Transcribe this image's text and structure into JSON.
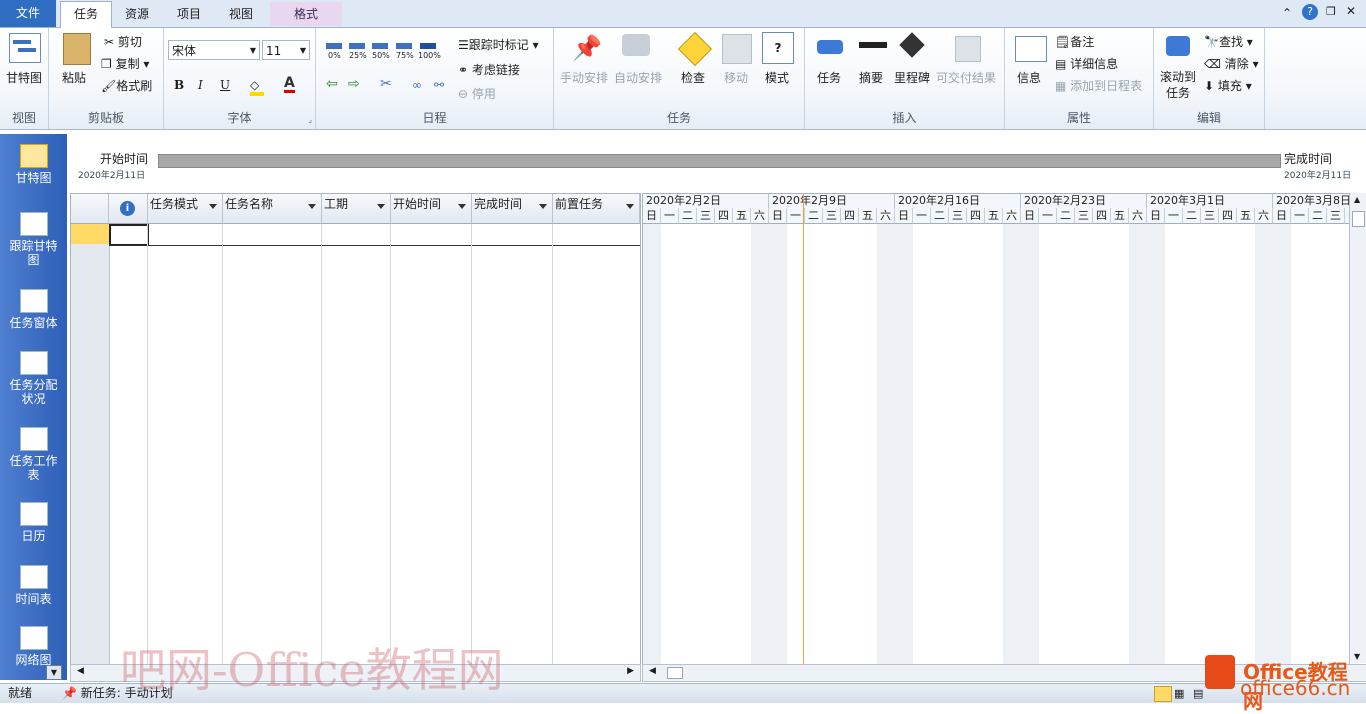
{
  "tabs": {
    "file": "文件",
    "items": [
      "任务",
      "资源",
      "项目",
      "视图"
    ],
    "format": "格式"
  },
  "ribbon": {
    "view": {
      "button": "甘特图",
      "label": "视图"
    },
    "clipboard": {
      "paste": "粘贴",
      "cut": "剪切",
      "copy": "复制",
      "format_painter": "格式刷",
      "label": "剪贴板"
    },
    "font": {
      "name": "宋体",
      "size": "11",
      "bold": "B",
      "italic": "I",
      "underline": "U",
      "label": "字体"
    },
    "schedule": {
      "pcts": [
        "0%",
        "25%",
        "50%",
        "75%",
        "100%"
      ],
      "track": "跟踪时标记",
      "respect": "考虑链接",
      "inactivate": "停用",
      "label": "日程"
    },
    "tasks": {
      "manual": "手动安排",
      "auto": "自动安排",
      "inspect": "检查",
      "move": "移动",
      "mode": "模式",
      "label": "任务"
    },
    "insert": {
      "task": "任务",
      "summary": "摘要",
      "milestone": "里程碑",
      "deliverable": "可交付结果",
      "label": "插入"
    },
    "properties": {
      "info": "信息",
      "notes": "备注",
      "details": "详细信息",
      "add_timeline": "添加到日程表",
      "label": "属性"
    },
    "editing": {
      "scroll": "滚动到任务",
      "find": "查找",
      "clear": "清除",
      "fill": "填充",
      "label": "编辑"
    }
  },
  "timeline": {
    "start_label": "开始时间",
    "start_date": "2020年2月11日",
    "finish_label": "完成时间",
    "finish_date": "2020年2月11日"
  },
  "leftbar": [
    "甘特图",
    "跟踪甘特图",
    "任务窗体",
    "任务分配状况",
    "任务工作表",
    "日历",
    "时间表",
    "网络图"
  ],
  "grid": {
    "columns": [
      "任务模式",
      "任务名称",
      "工期",
      "开始时间",
      "完成时间",
      "前置任务"
    ]
  },
  "gantt": {
    "weeks": [
      "2020年2月2日",
      "2020年2月9日",
      "2020年2月16日",
      "2020年2月23日",
      "2020年3月1日",
      "2020年3月8日"
    ],
    "days": [
      "日",
      "一",
      "二",
      "三",
      "四",
      "五",
      "六"
    ]
  },
  "status": {
    "ready": "就绪",
    "new_task": "新任务: 手动计划"
  },
  "watermark": "吧网-Office教程网",
  "logo": {
    "line1": "Office教程网",
    "line2": "office66.cn"
  },
  "colors": {
    "file_tab": "#2e6dc1",
    "leftbar": "#2e5fb8",
    "today_line": "#e8a33c",
    "format_tab": "#e9d6ef"
  }
}
